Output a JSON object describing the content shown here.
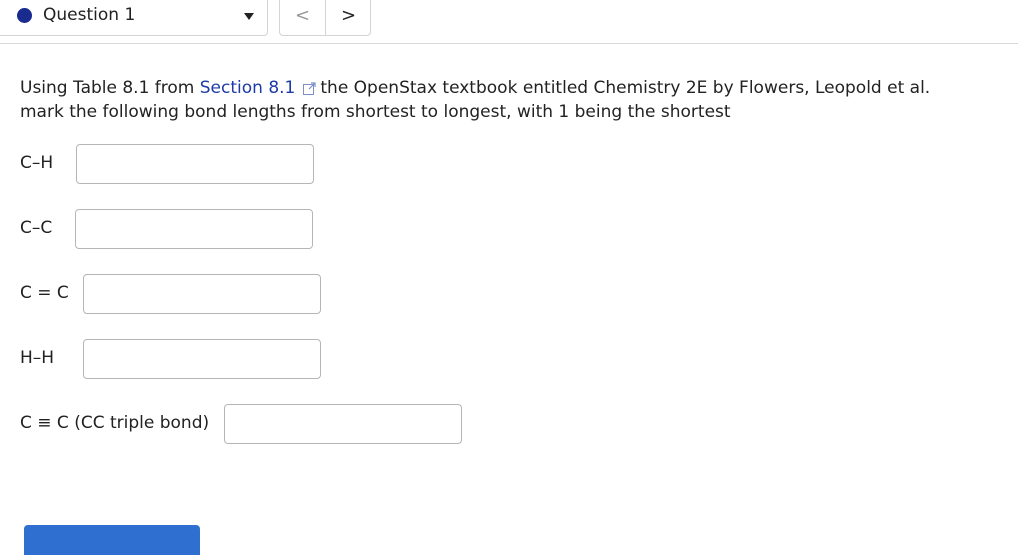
{
  "header": {
    "question_label": "Question 1",
    "prev_glyph": "<",
    "next_glyph": ">"
  },
  "instructions": {
    "before_link": "Using Table 8.1 from ",
    "link_text": "Section 8.1",
    "after_link": "the  OpenStax textbook entitled Chemistry 2E by Flowers, Leopold et al.",
    "line2": "mark the following bond lengths from shortest to longest, with 1 being the shortest"
  },
  "bonds": [
    {
      "label": "C–H",
      "value": ""
    },
    {
      "label": "C–C",
      "value": ""
    },
    {
      "label": "C = C",
      "value": ""
    },
    {
      "label": "H–H",
      "value": ""
    },
    {
      "label": "C ≡ C  (CC triple bond)",
      "value": ""
    }
  ],
  "colors": {
    "accent": "#1a2b8f",
    "link": "#1d3aa8",
    "button": "#2f6fd0"
  }
}
